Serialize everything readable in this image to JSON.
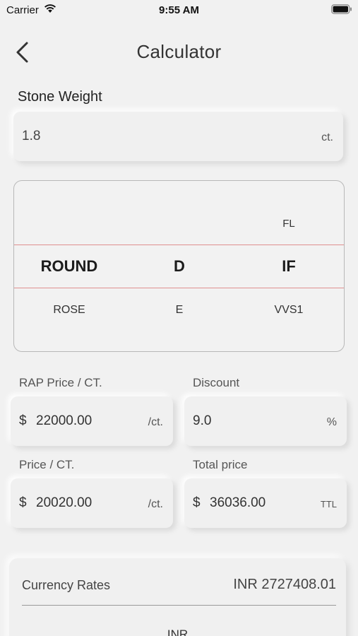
{
  "status_bar": {
    "carrier": "Carrier",
    "time": "9:55 AM"
  },
  "header": {
    "title": "Calculator"
  },
  "stone_weight": {
    "label": "Stone Weight",
    "value": "1.8",
    "unit": "ct."
  },
  "picker": {
    "shape": {
      "above": "",
      "selected": "ROUND",
      "below": "ROSE"
    },
    "color": {
      "above": "",
      "selected": "D",
      "below": "E"
    },
    "clarity": {
      "above": "FL",
      "selected": "IF",
      "below": "VVS1"
    }
  },
  "rap_price": {
    "label": "RAP Price / CT.",
    "currency": "$",
    "value": "22000.00",
    "unit": "/ct."
  },
  "discount": {
    "label": "Discount",
    "value": "9.0",
    "unit": "%"
  },
  "price_per_ct": {
    "label": "Price / CT.",
    "currency": "$",
    "value": "20020.00",
    "unit": "/ct."
  },
  "total_price": {
    "label": "Total price",
    "currency": "$",
    "value": "36036.00",
    "unit": "TTL"
  },
  "currency_rates": {
    "label": "Currency Rates",
    "value": "INR 2727408.01",
    "next_option": "INR"
  },
  "colors": {
    "background": "#f1f1f1",
    "selection_line": "#e09090",
    "border": "#b8b8b8"
  }
}
